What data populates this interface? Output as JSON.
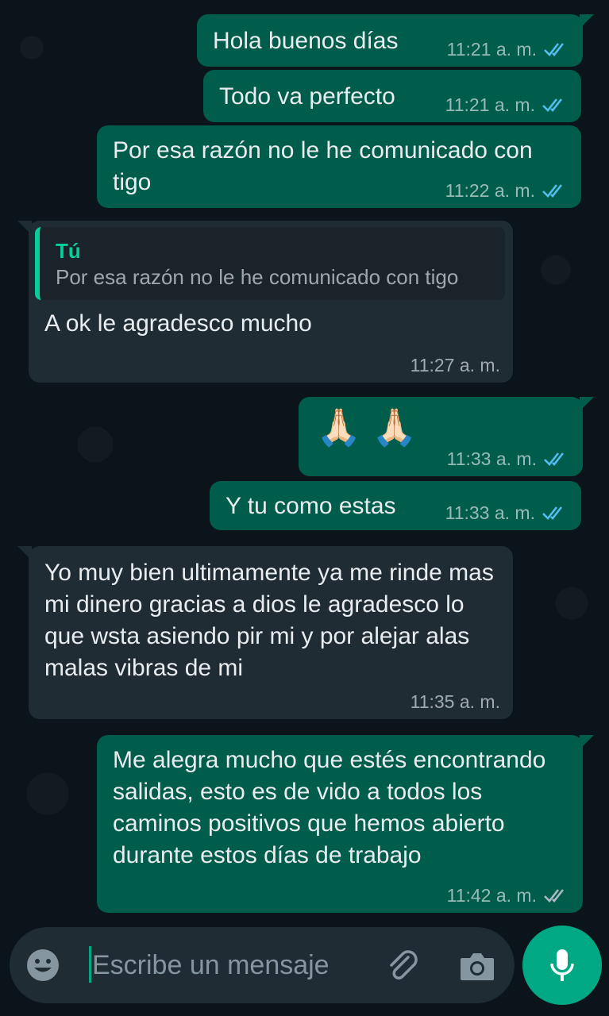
{
  "messages": [
    {
      "text": "Hola buenos días",
      "time": "11:21 a. m.",
      "status": "read"
    },
    {
      "text": "Todo va perfecto",
      "time": "11:21 a. m.",
      "status": "read"
    },
    {
      "text": "Por esa razón no le he comunicado con tigo",
      "time": "11:22 a. m.",
      "status": "read"
    },
    {
      "quote_author": "Tú",
      "quote_text": "Por esa razón no le he comunicado con tigo",
      "text": "A ok le agradesco mucho",
      "time": "11:27 a. m."
    },
    {
      "text": "🙏🏻 🙏🏻",
      "time": "11:33 a. m.",
      "status": "read"
    },
    {
      "text": "Y tu como estas",
      "time": "11:33 a. m.",
      "status": "read"
    },
    {
      "text": "Yo muy bien ultimamente ya me rinde mas mi dinero gracias a dios le agradesco lo que wsta asiendo pir mi y por alejar alas malas vibras de mi",
      "time": "11:35 a. m."
    },
    {
      "text": "Me alegra mucho que estés encontrando salidas, esto es de vido a todos los caminos positivos que hemos abierto durante estos días de trabajo",
      "time": "11:42 a. m.",
      "status": "delivered"
    }
  ],
  "input": {
    "placeholder": "Escribe un mensaje"
  },
  "icons": {
    "emoji": "emoji-icon",
    "attach": "paperclip-icon",
    "camera": "camera-icon",
    "mic": "mic-icon",
    "read_ticks": "double-check-blue-icon",
    "delivered_ticks": "double-check-grey-icon"
  },
  "colors": {
    "background": "#0b141a",
    "outgoing_bubble": "#005c4b",
    "incoming_bubble": "#1f2c34",
    "read_tick": "#53bdeb",
    "accent": "#00a884"
  }
}
